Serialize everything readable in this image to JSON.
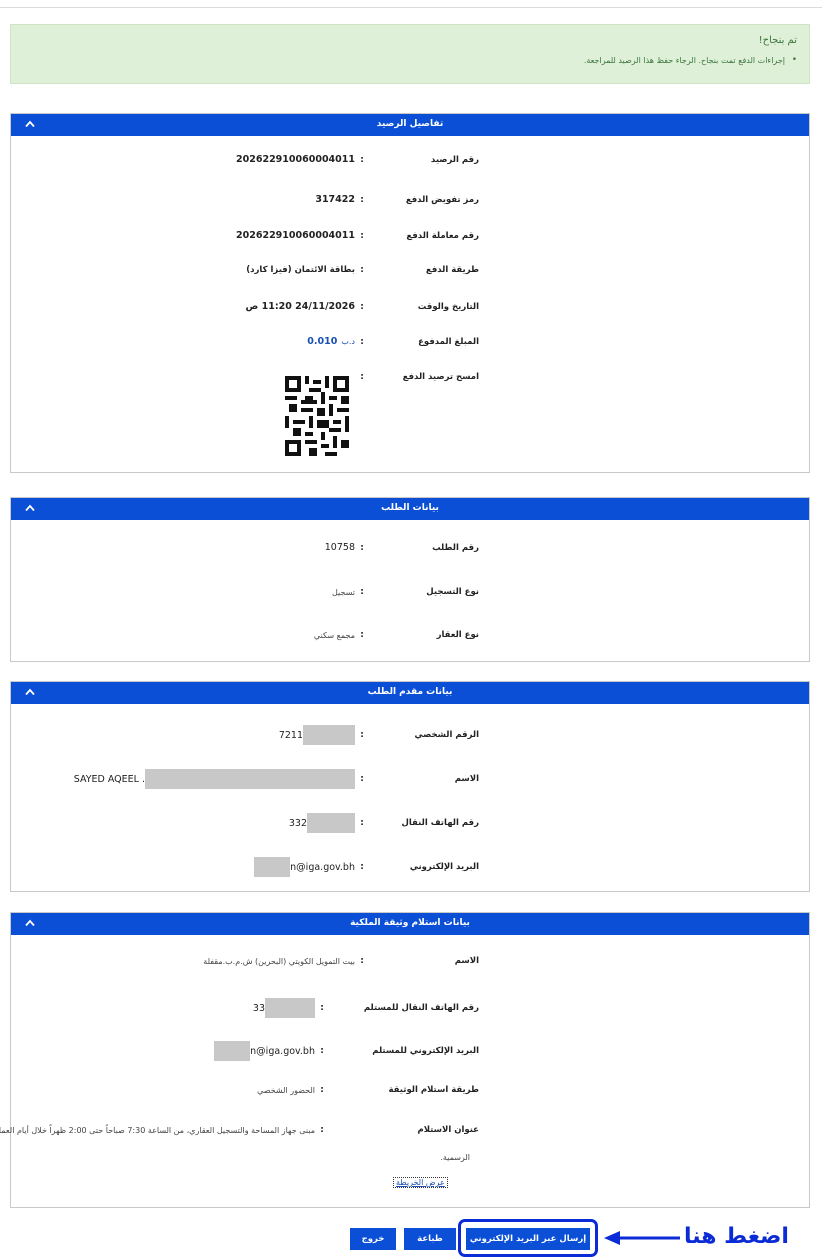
{
  "alert": {
    "title": "تم بنجاح!",
    "message": "إجراءات الدفع تمت بنجاح. الرجاء حفظ هذا الرصيد للمراجعة."
  },
  "receipt": {
    "title": "تفاصيل الرصيد",
    "fields": [
      {
        "label": "رقم الرصيد",
        "value": "202622910060004011"
      },
      {
        "label": "رمز تفويض الدفع",
        "value": "317422"
      },
      {
        "label": "رقم معاملة الدفع",
        "value": "202622910060004011"
      },
      {
        "label": "طريقة الدفع",
        "value": "بطاقة الائتمان (فيزا كارد)"
      },
      {
        "label": "التاريخ والوقت",
        "value": "24/11/2026 11:20 ص"
      },
      {
        "label": "المبلغ المدفوع",
        "value": "0.010",
        "currency": "د.ب"
      },
      {
        "label": "امسح ترصيد الدفع",
        "value": ""
      }
    ]
  },
  "request": {
    "title": "بيانات الطلب",
    "fields": [
      {
        "label": "رقم الطلب",
        "value": "10758"
      },
      {
        "label": "نوع التسجيل",
        "value": "تسجيل"
      },
      {
        "label": "نوع العقار",
        "value": "مجمع سكني"
      }
    ]
  },
  "applicant": {
    "title": "بيانات مقدم الطلب",
    "fields": [
      {
        "label": "الرقم الشخصي",
        "value": "7211"
      },
      {
        "label": "الاسم",
        "value": "SAYED AQEEL ."
      },
      {
        "label": "رقم الهاتف النقال",
        "value": "332"
      },
      {
        "label": "البريد الإلكتروني",
        "value": "n@iga.gov.bh"
      }
    ]
  },
  "delivery": {
    "title": "بيانات استلام وثيقة الملكية",
    "fields": [
      {
        "label": "الاسم",
        "value": "بيت التمويل الكويتي (البحرين) ش.م.ب.مقفلة"
      },
      {
        "label": "رقم الهاتف النقال للمستلم",
        "value": "33"
      },
      {
        "label": "البريد الإلكتروني للمستلم",
        "value": "n@iga.gov.bh"
      },
      {
        "label": "طريقة استلام الوثيقة",
        "value": "الحضور الشخصي"
      },
      {
        "label": "عنوان الاستلام",
        "value": "مبنى جهاز المساحة والتسجيل العقاري، من الساعة 7:30 صباحاً حتى 2:00 ظهراً خلال أيام العمل",
        "value2": "الرسمية."
      }
    ],
    "map_link": "عرض الخريطة"
  },
  "actions": {
    "email_button": "إرسال عبر البريد الإلكتروني",
    "print_button": "طباعة",
    "exit_button": "خروج",
    "callout": "اضغط هنا"
  },
  "colors": {
    "header_blue": "#0a4fd6",
    "callout_blue": "#0a2bd6",
    "success_bg": "#dff0d8"
  }
}
